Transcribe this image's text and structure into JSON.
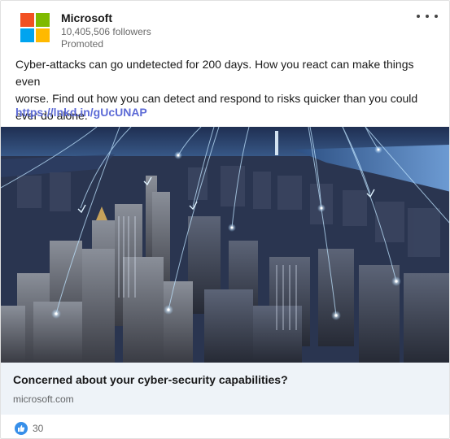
{
  "company": {
    "name": "Microsoft",
    "followers": "10,405,506 followers",
    "promoted_label": "Promoted",
    "logo_colors": [
      "#f25022",
      "#7fba00",
      "#00a4ef",
      "#ffb900"
    ]
  },
  "post": {
    "commentary_lines": [
      "Cyber-attacks can go undetected for 200 days. How you react can make things even",
      "worse. Find out how you can detect and respond to risks quicker than you could",
      "ever do alone."
    ],
    "link_text": "https://lnkd.in/gUcUNAP",
    "link_color": "#5d6bd6"
  },
  "card": {
    "headline": "Concerned about your cyber-security capabilities?",
    "domain": "microsoft.com"
  },
  "social": {
    "reaction_icon": "thumbs-up-icon",
    "reaction_count": "30"
  },
  "icons": {
    "more": "more-options-icon"
  }
}
